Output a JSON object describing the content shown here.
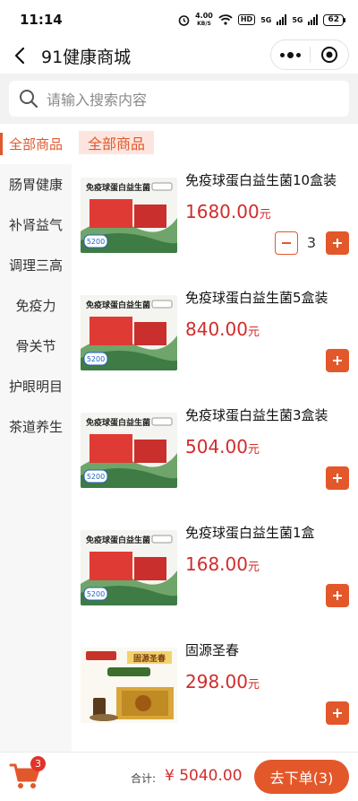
{
  "status_bar": {
    "time": "11:14",
    "net_speed_value": "4.00",
    "net_speed_unit": "KB/S",
    "hd_label": "HD",
    "signal_label_1": "5G",
    "signal_label_2": "5G",
    "battery": "62"
  },
  "nav": {
    "title": "91健康商城"
  },
  "search": {
    "placeholder": "请输入搜索内容"
  },
  "sidebar": {
    "items": [
      {
        "label": "全部商品",
        "active": true
      },
      {
        "label": "肠胃健康"
      },
      {
        "label": "补肾益气"
      },
      {
        "label": "调理三高"
      },
      {
        "label": "免疫力"
      },
      {
        "label": "骨关节"
      },
      {
        "label": "护眼明目"
      },
      {
        "label": "茶道养生"
      }
    ]
  },
  "main": {
    "section_title": "全部商品",
    "products": [
      {
        "name": "免疫球蛋白益生菌10盒装",
        "price": "1680.00",
        "unit": "元",
        "quantity": "3",
        "image_title": "免疫球蛋白益生菌",
        "image_badge": "5200"
      },
      {
        "name": "免疫球蛋白益生菌5盒装",
        "price": "840.00",
        "unit": "元",
        "image_title": "免疫球蛋白益生菌",
        "image_badge": "5200"
      },
      {
        "name": "免疫球蛋白益生菌3盒装",
        "price": "504.00",
        "unit": "元",
        "image_title": "免疫球蛋白益生菌",
        "image_badge": "5200"
      },
      {
        "name": "免疫球蛋白益生菌1盒",
        "price": "168.00",
        "unit": "元",
        "image_title": "免疫球蛋白益生菌",
        "image_badge": "5200"
      },
      {
        "name": "固源圣春",
        "price": "298.00",
        "unit": "元",
        "image_title": "固源圣春"
      }
    ]
  },
  "bottom": {
    "cart_count": "3",
    "total_label": "合计:",
    "total_value": "¥ 5040.00",
    "checkout_label": "去下单(3)"
  },
  "colors": {
    "accent": "#e3582a",
    "price": "#d22c2c",
    "section_bg": "#fde5df"
  }
}
